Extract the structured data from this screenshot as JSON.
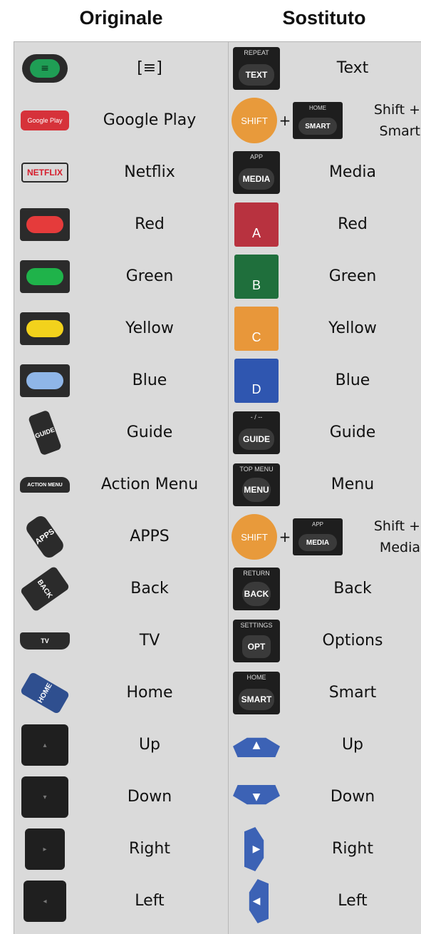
{
  "header": {
    "original": "Originale",
    "substitute": "Sostituto"
  },
  "rows": [
    {
      "orig_text": "[≡]",
      "subs_text": "Text",
      "subs_top": "REPEAT",
      "subs_btn": "TEXT"
    },
    {
      "orig_text": "Google Play",
      "orig_logo": "Google Play",
      "subs_shift": "SHIFT",
      "subs_plus": "+",
      "subs_top": "HOME",
      "subs_btn": "SMART",
      "subs_text_1": "Shift +",
      "subs_text_2": "Smart"
    },
    {
      "orig_text": "Netflix",
      "orig_logo": "NETFLIX",
      "subs_text": "Media",
      "subs_top": "APP",
      "subs_btn": "MEDIA"
    },
    {
      "orig_text": "Red",
      "subs_letter": "A",
      "subs_text": "Red"
    },
    {
      "orig_text": "Green",
      "subs_letter": "B",
      "subs_text": "Green"
    },
    {
      "orig_text": "Yellow",
      "subs_letter": "C",
      "subs_text": "Yellow"
    },
    {
      "orig_text": "Blue",
      "subs_letter": "D",
      "subs_text": "Blue"
    },
    {
      "orig_text": "Guide",
      "orig_key": "GUIDE",
      "subs_top": "- / --",
      "subs_btn": "GUIDE",
      "subs_text": "Guide"
    },
    {
      "orig_text": "Action Menu",
      "orig_key": "ACTION MENU",
      "subs_top": "TOP MENU",
      "subs_btn": "MENU",
      "subs_text": "Menu"
    },
    {
      "orig_text": "APPS",
      "orig_key": "APPS",
      "subs_shift": "SHIFT",
      "subs_plus": "+",
      "subs_top": "APP",
      "subs_btn": "MEDIA",
      "subs_text_1": "Shift +",
      "subs_text_2": "Media"
    },
    {
      "orig_text": "Back",
      "orig_key": "BACK",
      "subs_top": "RETURN",
      "subs_btn": "BACK",
      "subs_text": "Back"
    },
    {
      "orig_text": "TV",
      "orig_key": "TV",
      "subs_top": "SETTINGS",
      "subs_btn": "OPT",
      "subs_text": "Options"
    },
    {
      "orig_text": "Home",
      "orig_key": "HOME",
      "subs_top": "HOME",
      "subs_btn": "SMART",
      "subs_text": "Smart"
    },
    {
      "orig_text": "Up",
      "subs_text": "Up"
    },
    {
      "orig_text": "Down",
      "subs_text": "Down"
    },
    {
      "orig_text": "Right",
      "subs_text": "Right"
    },
    {
      "orig_text": "Left",
      "subs_text": "Left"
    }
  ],
  "colors": {
    "red_pill": "#e53b3b",
    "green_pill": "#1fb34a",
    "yellow_pill": "#f2d21c",
    "blue_pill": "#8fb6e8",
    "red_key": "#b8323f",
    "green_key": "#1f6f3c",
    "yellow_key": "#e8973a",
    "blue_key": "#2f56b0",
    "shift": "#e89a3b",
    "nav": "#3c62b5"
  },
  "icons": {
    "text_remote_icon": "green-list-button-icon",
    "guide_icon": "guide-key-icon",
    "arrow_up": "▲",
    "arrow_down": "▼",
    "arrow_right": "▶",
    "arrow_left": "◀"
  }
}
